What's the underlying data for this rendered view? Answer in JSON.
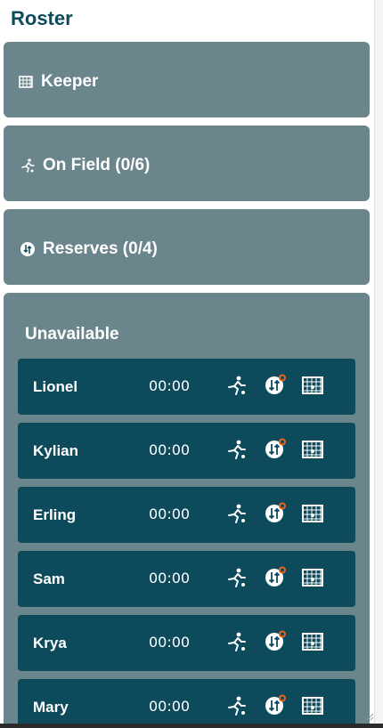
{
  "title": "Roster",
  "sections": {
    "keeper": {
      "label": "Keeper"
    },
    "on_field": {
      "label": "On Field (0/6)"
    },
    "reserves": {
      "label": "Reserves (0/4)"
    },
    "unavailable": {
      "label": "Unavailable"
    }
  },
  "players": [
    {
      "name": "Lionel",
      "time": "00:00"
    },
    {
      "name": "Kylian",
      "time": "00:00"
    },
    {
      "name": "Erling",
      "time": "00:00"
    },
    {
      "name": "Sam",
      "time": "00:00"
    },
    {
      "name": "Krya",
      "time": "00:00"
    },
    {
      "name": "Mary",
      "time": "00:00"
    }
  ],
  "colors": {
    "title": "#0d4a5c",
    "panel": "#6b858c",
    "row": "#0d4a5c",
    "badge": "#e8641e"
  },
  "icons": [
    "goal-icon",
    "runner-icon",
    "substitute-icon"
  ]
}
